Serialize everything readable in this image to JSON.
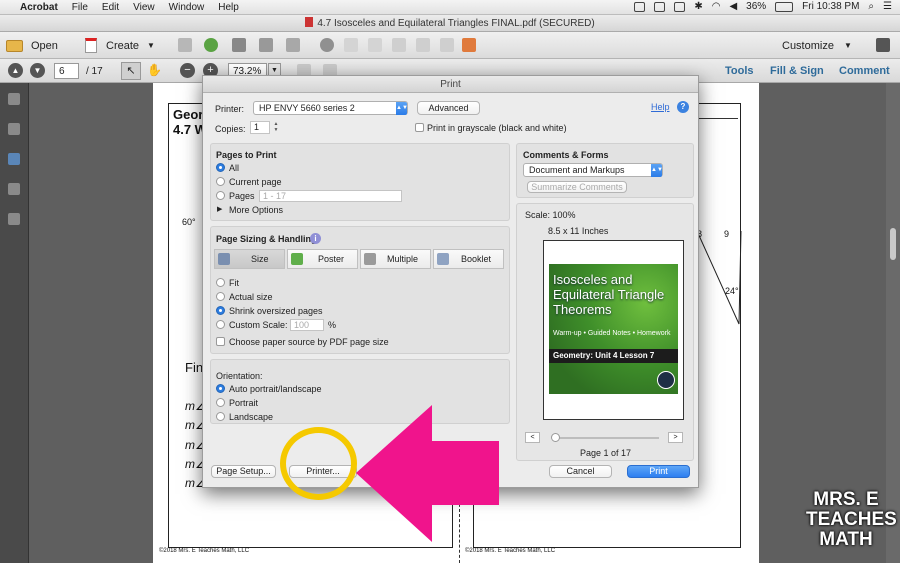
{
  "menubar": {
    "app": "Acrobat",
    "items": [
      "File",
      "Edit",
      "View",
      "Window",
      "Help"
    ],
    "battery": "36%",
    "clock": "Fri 10:38 PM"
  },
  "window": {
    "title": "4.7 Isosceles and Equilateral Triangles FINAL.pdf (SECURED)"
  },
  "toolbar": {
    "open": "Open",
    "create": "Create",
    "customize": "Customize"
  },
  "nav": {
    "page_value": "6",
    "page_total": "/ 17",
    "zoom": "73.2%",
    "links": [
      "Tools",
      "Fill & Sign",
      "Comment"
    ]
  },
  "document": {
    "heading1": "Geor",
    "heading2": "4.7 W",
    "angle_left": "60°",
    "angle_right": "24°",
    "num_a": "8",
    "num_b": "9",
    "find": "Fin",
    "rows": [
      "m∠",
      "m∠",
      "m∠",
      "m∠",
      "m∠"
    ],
    "footer_left": "©2018 Mrs. E Teaches Math, LLC",
    "footer_right": "©2018 Mrs. E Teaches Math, LLC"
  },
  "dialog": {
    "title": "Print",
    "printer_label": "Printer:",
    "printer_value": "HP ENVY 5660 series 2",
    "advanced": "Advanced",
    "help": "Help",
    "copies_label": "Copies:",
    "copies_value": "1",
    "grayscale": "Print in grayscale (black and white)",
    "pages": {
      "heading": "Pages to Print",
      "all": "All",
      "current": "Current page",
      "pages": "Pages",
      "range": "1 - 17",
      "more": "More Options"
    },
    "sizing": {
      "heading": "Page Sizing & Handling",
      "tabs": [
        "Size",
        "Poster",
        "Multiple",
        "Booklet"
      ],
      "fit": "Fit",
      "actual": "Actual size",
      "shrink": "Shrink oversized pages",
      "custom": "Custom Scale:",
      "custom_value": "100",
      "percent": "%",
      "paper_source": "Choose paper source by PDF page size"
    },
    "orientation": {
      "heading": "Orientation:",
      "auto": "Auto portrait/landscape",
      "portrait": "Portrait",
      "landscape": "Landscape"
    },
    "comments": {
      "heading": "Comments & Forms",
      "value": "Document and Markups",
      "summarize": "Summarize Comments"
    },
    "preview": {
      "scale": "Scale: 100%",
      "size": "8.5 x 11 Inches",
      "cover_title": "Isosceles and Equilateral Triangle Theorems",
      "cover_sub": "Warm-up • Guided Notes • Homework",
      "cover_bar": "Geometry: Unit 4 Lesson 7",
      "page_status": "Page 1 of 17"
    },
    "buttons": {
      "page_setup": "Page Setup...",
      "printer": "Printer...",
      "cancel": "Cancel",
      "print": "Print"
    }
  },
  "brand": {
    "line1": "MRS. E",
    "line2": "TEACHES",
    "line3": "MATH"
  },
  "colors": {
    "highlight_ring": "#f5c900",
    "arrow": "#f0148c",
    "accent": "#2d7ef0",
    "link": "#2f6b9a"
  }
}
